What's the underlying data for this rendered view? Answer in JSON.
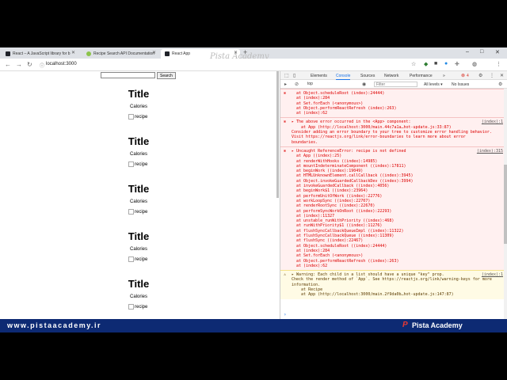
{
  "tabs": [
    {
      "label": "React – A JavaScript library for b",
      "favicon_color": "#61dafb"
    },
    {
      "label": "Recipe Search API Documentation",
      "favicon_color": "#8bc34a"
    },
    {
      "label": "React App",
      "favicon_color": "#61dafb"
    }
  ],
  "new_tab": "+",
  "watermark": "Pista Academy",
  "window_controls": {
    "minimize": "–",
    "maximize": "□",
    "close": "✕"
  },
  "address": {
    "url": "localhost:3000"
  },
  "page": {
    "search_placeholder": "",
    "search_button": "Search",
    "recipes": [
      {
        "title": "Title",
        "calories": "Calories",
        "image_alt": "recipe"
      },
      {
        "title": "Title",
        "calories": "Calories",
        "image_alt": "recipe"
      },
      {
        "title": "Title",
        "calories": "Calories",
        "image_alt": "recipe"
      },
      {
        "title": "Title",
        "calories": "Calories",
        "image_alt": "recipe"
      },
      {
        "title": "Title",
        "calories": "Calories",
        "image_alt": "recipe"
      }
    ]
  },
  "devtools": {
    "tabs": [
      "Elements",
      "Console",
      "Sources",
      "Network",
      "Performance"
    ],
    "active_tab": "Console",
    "more": "»",
    "error_badge": "4",
    "context": "top",
    "filter_placeholder": "Filter",
    "levels": "All levels ▾",
    "issues": "No Issues",
    "messages": [
      {
        "type": "error",
        "src": "",
        "lines": [
          "  at Object.scheduleRoot (index):24444)",
          "  at (index):284",
          "  at Set.forEach (<anonymous>)",
          "  at Object.performReactRefresh (index):263)",
          "  at (index):62"
        ]
      },
      {
        "type": "error",
        "src": "(index):1",
        "lines": [
          "▸ The above error occurred in the <App> component:",
          "",
          "    at App (http://localhost:3000/main.44c7a1a…hot-update.js:33:87)",
          "",
          "Consider adding an error boundary to your tree to customize error handling behavior.",
          "Visit https://reactjs.org/link/error-boundaries to learn more about error",
          "boundaries."
        ]
      },
      {
        "type": "error",
        "src": "(index):315",
        "lines": [
          "▸ Uncaught ReferenceError: recipe is not defined",
          "  at App ((index):25)",
          "  at renderWithHooks ((index):14985)",
          "  at mountIndeterminateComponent ((index):17811)",
          "  at beginWork ((index):19049)",
          "  at HTMLUnknownElement.callCallback ((index):3945)",
          "  at Object.invokeGuardedCallbackDev ((index):3994)",
          "  at invokeGuardedCallback ((index):4056)",
          "  at beginWork$1 ((index):23964)",
          "  at performUnitOfWork ((index):22776)",
          "  at workLoopSync ((index):22707)",
          "  at renderRootSync ((index):22670)",
          "  at performSyncWorkOnRoot ((index):22293)",
          "  at (index):11327",
          "  at unstable_runWithPriority ((index):468)",
          "  at runWithPriority$1 ((index):11276)",
          "  at flushSyncCallbackQueueImpl ((index):11322)",
          "  at flushSyncCallbackQueue ((index):11309)",
          "  at flushSync ((index):22467)",
          "  at Object.scheduleRoot ((index):24444)",
          "  at (index):284",
          "  at Set.forEach (<anonymous>)",
          "  at Object.performReactRefresh ((index):263)",
          "  at (index):62"
        ]
      },
      {
        "type": "warn",
        "src": "(index):1",
        "lines": [
          "▸ Warning: Each child in a list should have a unique \"key\" prop.",
          "",
          "Check the render method of `App`. See https://reactjs.org/link/warning-keys for more",
          "information.",
          "    at Recipe",
          "    at App (http://localhost:3000/main.2f9da0b…hot-update.js:147:87)"
        ]
      }
    ],
    "prompt": "›"
  },
  "banner": {
    "site": "www.pistaacademy.ir",
    "brand": "Pista Academy",
    "logo": "P"
  },
  "colors": {
    "banner": "#0d2a73",
    "error_bg": "#fff0f0",
    "accent": "#1a73e8"
  }
}
